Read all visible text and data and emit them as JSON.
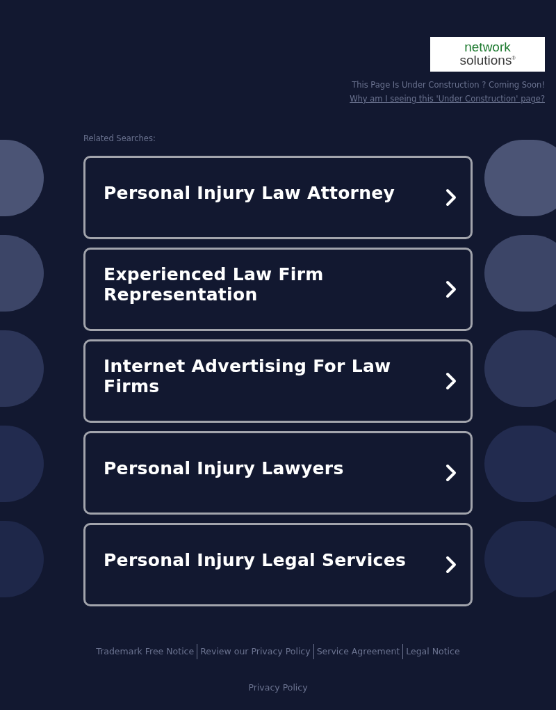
{
  "logo": {
    "line_1": "network",
    "line_2": "solutions",
    "mark": "®"
  },
  "notice": "This Page Is Under Construction ? Coming Soon!",
  "notice_link": "Why am I seeing this 'Under Construction' page?",
  "related_label": "Related Searches:",
  "searches": [
    {
      "title": "Personal Injury Law Attorney"
    },
    {
      "title": "Experienced Law Firm Representation"
    },
    {
      "title": "Internet Advertising For Law Firms"
    },
    {
      "title": "Personal Injury Lawyers"
    },
    {
      "title": "Personal Injury Legal Services"
    }
  ],
  "footer_links": [
    "Trademark Free Notice",
    "Review our Privacy Policy",
    "Service Agreement",
    "Legal Notice"
  ],
  "privacy_link": "Privacy Policy"
}
